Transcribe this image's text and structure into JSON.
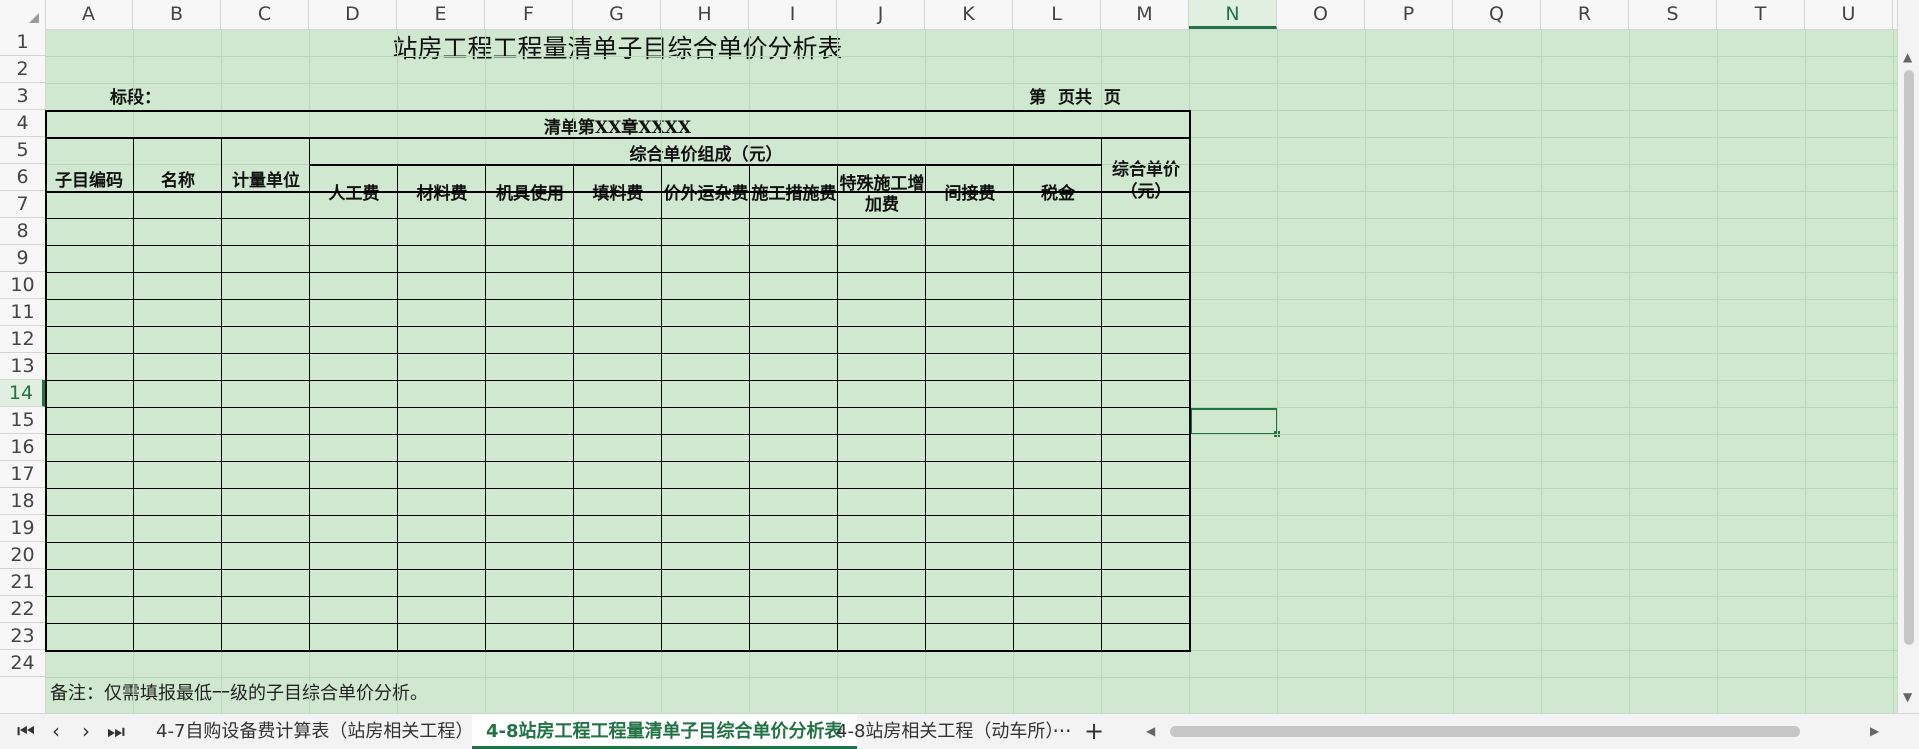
{
  "columns": [
    "A",
    "B",
    "C",
    "D",
    "E",
    "F",
    "G",
    "H",
    "I",
    "J",
    "K",
    "L",
    "M",
    "N",
    "O",
    "P",
    "Q",
    "R",
    "S",
    "T",
    "U"
  ],
  "selected_column": "N",
  "rows": [
    "1",
    "2",
    "3",
    "4",
    "5",
    "6",
    "7",
    "8",
    "9",
    "10",
    "11",
    "12",
    "13",
    "14",
    "15",
    "16",
    "17",
    "18",
    "19",
    "20",
    "21",
    "22",
    "23",
    "24"
  ],
  "selected_row": "14",
  "sheet": {
    "title": "站房工程工程量清单子目综合单价分析表",
    "section_label": "标段：",
    "page_label": "第  页共  页",
    "chapter_header": "清单第XX章XXXX",
    "group_header": "综合单价组成（元）",
    "headers": {
      "code": "子目编码",
      "name": "名称",
      "unit": "计量单位",
      "labor": "人工费",
      "material": "材料费",
      "machine": "机具使用",
      "fill": "填料费",
      "transport": "价外运杂费",
      "measures": "施工措施费",
      "special": "特殊施工增加费",
      "indirect": "间接费",
      "tax": "税金",
      "unit_price": "综合单价（元）"
    },
    "note": "备注：仅需填报最低一级的子目综合单价分析。"
  },
  "tabs": [
    {
      "label": "4-7自购设备费计算表（站房相关工程）",
      "active": false
    },
    {
      "label": "4-8站房工程工程量清单子目综合单价分析表",
      "active": true
    },
    {
      "label": "4-8站房相关工程（动车所）",
      "active": false
    }
  ],
  "tab_bar": {
    "more": "···",
    "add": "+"
  },
  "nav_icons": [
    "first-sheet-icon",
    "prev-sheet-icon",
    "next-sheet-icon",
    "last-sheet-icon"
  ],
  "colors": {
    "accent": "#217346",
    "sheet_bg": "#cfe8cf"
  }
}
